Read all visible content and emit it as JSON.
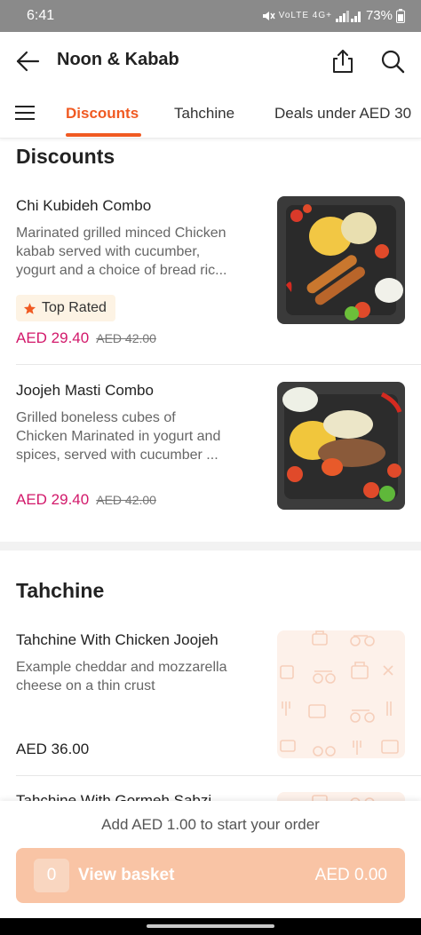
{
  "status": {
    "time": "6:41",
    "battery": "73%",
    "indicators": "VoLTE 4G+"
  },
  "header": {
    "title": "Noon & Kabab"
  },
  "tabs": [
    {
      "label": "Discounts",
      "active": true
    },
    {
      "label": "Tahchine",
      "active": false
    },
    {
      "label": "Deals under AED 30",
      "active": false
    }
  ],
  "sections": [
    {
      "title": "Discounts",
      "items": [
        {
          "name": "Chi Kubideh Combo",
          "desc_lines": [
            "Marinated grilled minced Chicken",
            "kabab served with cucumber,",
            "yogurt and a choice of bread ric..."
          ],
          "badge": "Top Rated",
          "price": "AED 29.40",
          "old_price": "AED 42.00"
        },
        {
          "name": "Joojeh Masti Combo",
          "desc_lines": [
            "Grilled boneless cubes of",
            "Chicken Marinated in yogurt and",
            "spices, served with cucumber ..."
          ],
          "price": "AED 29.40",
          "old_price": "AED 42.00"
        }
      ]
    },
    {
      "title": "Tahchine",
      "items": [
        {
          "name": "Tahchine With Chicken Joojeh",
          "desc_lines": [
            "Example cheddar and mozzarella",
            "cheese on a thin crust"
          ],
          "price": "AED 36.00"
        },
        {
          "name": "Tahchine With Gormeh Sabzi"
        }
      ]
    }
  ],
  "basket": {
    "message": "Add AED 1.00 to start your order",
    "count": "0",
    "label": "View basket",
    "total": "AED 0.00"
  },
  "colors": {
    "accent": "#f05a22",
    "price": "#d2186a",
    "basket": "#f9c4a5"
  }
}
